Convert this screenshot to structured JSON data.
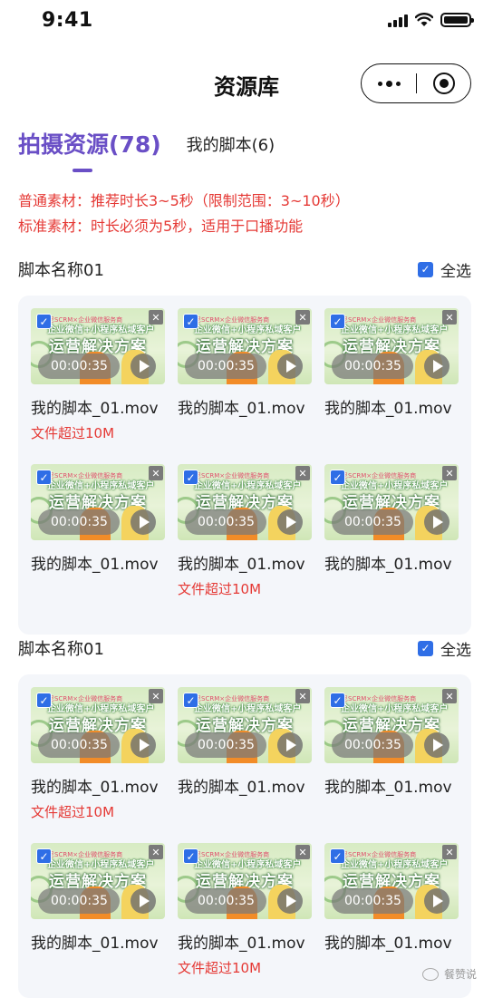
{
  "status": {
    "time": "9:41"
  },
  "nav": {
    "title": "资源库"
  },
  "tabs": [
    {
      "label": "拍摄资源(78)",
      "active": true
    },
    {
      "label": "我的脚本(6)",
      "active": false
    }
  ],
  "notes": [
    "普通素材：推荐时长3~5秒（限制范围：3~10秒）",
    "标准素材：时长必须为5秒，适用于口播功能"
  ],
  "thumbnail": {
    "banner": "伊尼SCRM×企业微信服务商",
    "line1": "企业微信+小程序私域客户",
    "line2": "运营解决方案",
    "duration": "00:00:35"
  },
  "sections": [
    {
      "title": "脚本名称01",
      "select_all": "全选",
      "items": [
        {
          "name": "我的脚本_01.mov",
          "warning": "文件超过10M"
        },
        {
          "name": "我的脚本_01.mov",
          "warning": ""
        },
        {
          "name": "我的脚本_01.mov",
          "warning": ""
        },
        {
          "name": "我的脚本_01.mov",
          "warning": ""
        },
        {
          "name": "我的脚本_01.mov",
          "warning": "文件超过10M"
        },
        {
          "name": "我的脚本_01.mov",
          "warning": ""
        }
      ]
    },
    {
      "title": "脚本名称01",
      "select_all": "全选",
      "items": [
        {
          "name": "我的脚本_01.mov",
          "warning": "文件超过10M"
        },
        {
          "name": "我的脚本_01.mov",
          "warning": ""
        },
        {
          "name": "我的脚本_01.mov",
          "warning": ""
        },
        {
          "name": "我的脚本_01.mov",
          "warning": ""
        },
        {
          "name": "我的脚本_01.mov",
          "warning": "文件超过10M"
        },
        {
          "name": "我的脚本_01.mov",
          "warning": ""
        }
      ]
    }
  ],
  "watermark": {
    "text": "餐赞说"
  },
  "colors": {
    "accent": "#6A4FC6",
    "warning": "#E53935",
    "checkbox": "#2F6EE6"
  }
}
